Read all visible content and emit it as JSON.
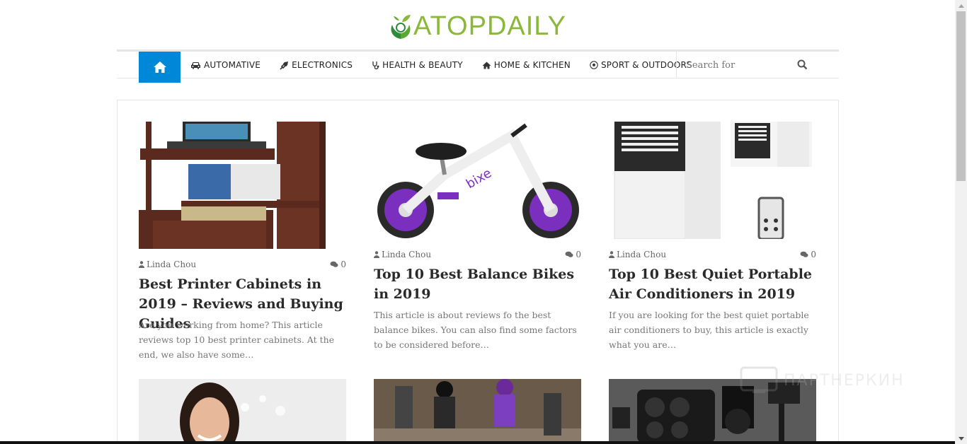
{
  "site": {
    "logo_text": "ATOPDAILY",
    "accent": "#0088d8",
    "logo_color": "#8cb83a"
  },
  "nav": {
    "home_icon": "home-icon",
    "items": [
      {
        "label": "AUTOMATIVE",
        "icon": "car-icon"
      },
      {
        "label": "ELECTRONICS",
        "icon": "plug-icon"
      },
      {
        "label": "HEALTH & BEAUTY",
        "icon": "stethoscope-icon"
      },
      {
        "label": "HOME & KITCHEN",
        "icon": "house-icon"
      },
      {
        "label": "SPORT & OUTDOORS",
        "icon": "soccer-ball-icon"
      }
    ],
    "search_placeholder": "Search for"
  },
  "posts": [
    {
      "author": "Linda Chou",
      "comments": "0",
      "title": "Best Printer Cabinets in 2019 – Reviews and Buying Guides",
      "excerpt": "Are you working from home? This article reviews top 10 best printer cabinets. At the end, we also have some…",
      "image": "printer-cabinet-image"
    },
    {
      "author": "Linda Chou",
      "comments": "0",
      "title": "Top 10 Best Balance Bikes in 2019",
      "excerpt": "This article is about reviews fo the best balance bikes. You can also find some factors to be considered before…",
      "image": "balance-bike-image"
    },
    {
      "author": "Linda Chou",
      "comments": "0",
      "title": "Top 10 Best Quiet Portable Air Conditioners in 2019",
      "excerpt": "If you are looking for the best quiet portable air conditioners to buy, this article is exactly what you are…",
      "image": "air-conditioner-image"
    }
  ],
  "lower_posts": [
    {
      "image": "woman-portrait-image"
    },
    {
      "image": "roller-derby-image"
    },
    {
      "image": "camera-gear-image"
    }
  ],
  "watermark": "ПАРТНЕРКИН"
}
